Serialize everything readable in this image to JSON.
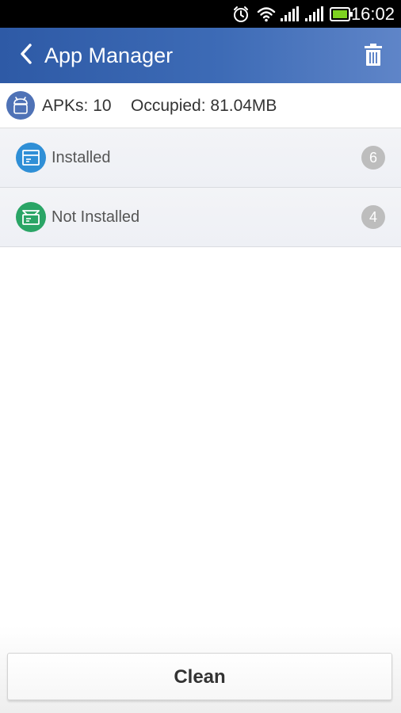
{
  "status_bar": {
    "time": "16:02",
    "icons": [
      "alarm-icon",
      "wifi-icon",
      "signal-icon",
      "signal-icon",
      "battery-icon"
    ],
    "battery_color": "#7ed321"
  },
  "header": {
    "title": "App Manager",
    "back_icon": "chevron-left-icon",
    "delete_icon": "trash-icon",
    "background_color": "#2e5aa6"
  },
  "summary": {
    "icon": "android-icon",
    "apks_label": "APKs: 10",
    "occupied_label": "Occupied: 81.04MB"
  },
  "categories": [
    {
      "label": "Installed",
      "count": "6",
      "icon": "package-icon",
      "icon_color": "#2f8fd6"
    },
    {
      "label": "Not Installed",
      "count": "4",
      "icon": "package-open-icon",
      "icon_color": "#2aa566"
    }
  ],
  "actions": {
    "clean_label": "Clean"
  }
}
